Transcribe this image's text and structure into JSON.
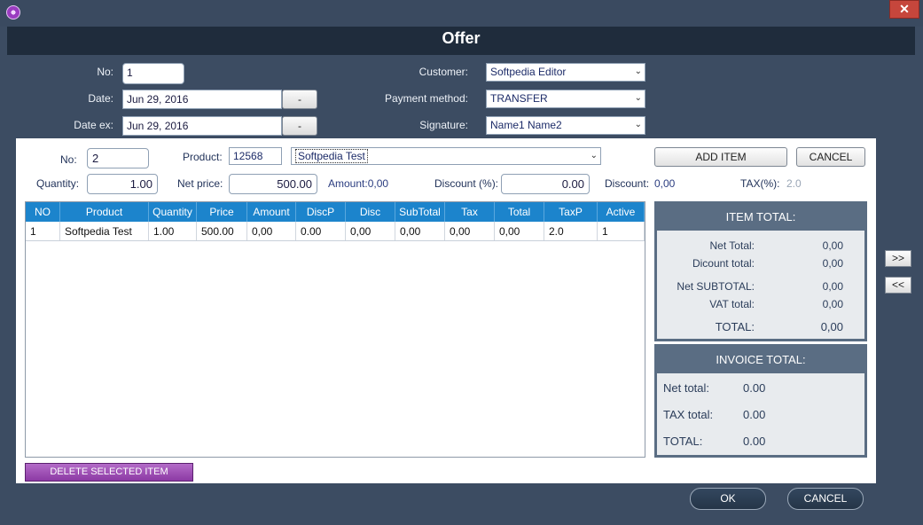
{
  "window": {
    "close_glyph": "✕"
  },
  "header": {
    "title": "Offer"
  },
  "form": {
    "no_label": "No:",
    "no_value": "1",
    "date_label": "Date:",
    "date_value": "Jun 29, 2016",
    "date_btn": "-",
    "date_ex_label": "Date ex:",
    "date_ex_value": "Jun 29, 2016",
    "date_ex_btn": "-",
    "customer_label": "Customer:",
    "customer_value": "Softpedia Editor",
    "payment_label": "Payment method:",
    "payment_value": "TRANSFER",
    "signature_label": "Signature:",
    "signature_value": "Name1 Name2"
  },
  "item": {
    "no_label": "No:",
    "no_value": "2",
    "product_label": "Product:",
    "product_code": "12568",
    "product_name": "Softpedia Test",
    "quantity_label": "Quantity:",
    "quantity_value": "1.00",
    "net_price_label": "Net price:",
    "net_price_value": "500.00",
    "amount_text": "Amount:0,00",
    "discount_pct_label": "Discount (%):",
    "discount_pct_value": "0.00",
    "discount_label": "Discount:",
    "discount_value": "0,00",
    "tax_label": "TAX(%):",
    "tax_value": "2.0",
    "add_btn": "ADD ITEM",
    "cancel_btn": "CANCEL"
  },
  "table": {
    "columns": [
      "NO",
      "Product",
      "Quantity",
      "Price",
      "Amount",
      "DiscP",
      "Disc",
      "SubTotal",
      "Tax",
      "Total",
      "TaxP",
      "Active"
    ],
    "rows": [
      [
        "1",
        "Softpedia Test",
        "1.00",
        "500.00",
        "0,00",
        "0.00",
        "0,00",
        "0,00",
        "0,00",
        "0,00",
        "2.0",
        "1"
      ]
    ]
  },
  "delete_btn": "DELETE SELECTED ITEM",
  "item_total": {
    "title": "ITEM TOTAL:",
    "net_total_label": "Net Total:",
    "net_total": "0,00",
    "discount_total_label": "Dicount total:",
    "discount_total": "0,00",
    "net_subtotal_label": "Net SUBTOTAL:",
    "net_subtotal": "0,00",
    "vat_total_label": "VAT total:",
    "vat_total": "0,00",
    "total_label": "TOTAL:",
    "total": "0,00"
  },
  "invoice_total": {
    "title": "INVOICE TOTAL:",
    "net_total_label": "Net total:",
    "net_total": "0.00",
    "tax_total_label": "TAX total:",
    "tax_total": "0.00",
    "total_label": "TOTAL:",
    "total": "0.00"
  },
  "nav": {
    "forward": ">>",
    "back": "<<"
  },
  "footer": {
    "ok": "OK",
    "cancel": "CANCEL"
  },
  "colors": {
    "header_bg": "#1f2c3c",
    "table_header": "#1c84cc",
    "delete_btn": "#a055b8",
    "side_panel": "#5a6d83"
  }
}
